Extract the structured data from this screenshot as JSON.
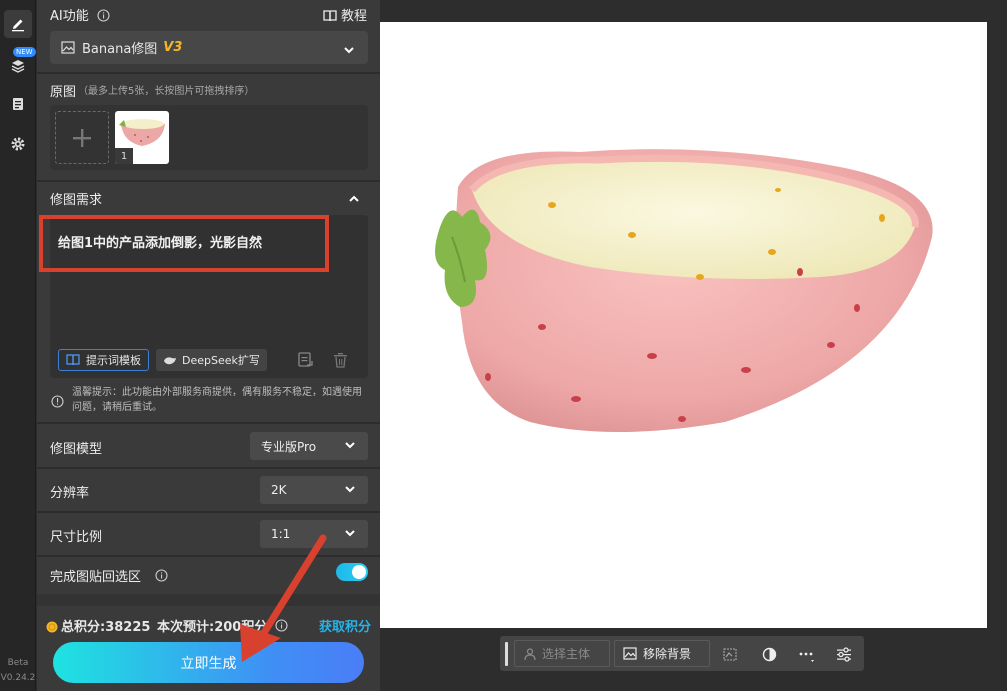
{
  "rail": {
    "new_badge": "NEW",
    "beta": "Beta",
    "version": "V0.24.2",
    "icons": [
      "pen-icon",
      "layers-icon",
      "clipboard-icon",
      "gear-icon"
    ]
  },
  "header": {
    "title": "AI功能",
    "tutorial": "教程"
  },
  "model_select": {
    "name": "Banana修图",
    "version": "V3"
  },
  "source": {
    "label": "原图",
    "hint": "（最多上传5张，长按图片可拖拽排序）",
    "thumb_index": "1"
  },
  "requirement": {
    "label": "修图需求",
    "prompt": "给图1中的产品添加倒影，光影自然",
    "template_button": "提示词模板",
    "deepseek_button": "DeepSeek扩写"
  },
  "warning": "温馨提示：此功能由外部服务商提供，偶有服务不稳定，如遇使用问题，请稍后重试。",
  "settings": {
    "model_label": "修图模型",
    "model_value": "专业版Pro",
    "resolution_label": "分辨率",
    "resolution_value": "2K",
    "ratio_label": "尺寸比例",
    "ratio_value": "1:1",
    "paste_back_label": "完成图贴回选区",
    "paste_back_on": true
  },
  "points": {
    "total": "总积分:38225",
    "estimate": "本次预计:200积分",
    "get_points": "获取积分"
  },
  "generate_button": "立即生成",
  "toolbar": {
    "select_subject": "选择主体",
    "remove_bg": "移除背景"
  },
  "colors": {
    "accent_cyan": "#1ee3e0",
    "accent_blue": "#4a7df7",
    "link": "#27b2e8",
    "highlight_red": "#d9412f",
    "v3_yellow": "#f3b628"
  }
}
